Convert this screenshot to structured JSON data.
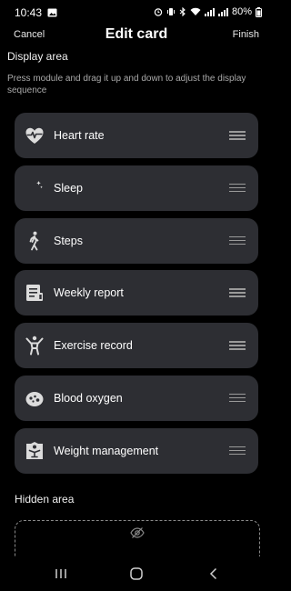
{
  "status_bar": {
    "time": "10:43",
    "battery": "80%",
    "icons": [
      "image-icon",
      "alarm-icon",
      "vibrate-icon",
      "bluetooth-icon",
      "wifi-icon",
      "signal-icon",
      "signal-icon",
      "battery-icon"
    ]
  },
  "header": {
    "cancel_label": "Cancel",
    "title": "Edit card",
    "finish_label": "Finish"
  },
  "display_area": {
    "title": "Display area",
    "description": "Press module and drag it up and down to adjust the display sequence"
  },
  "modules": [
    {
      "label": "Heart rate",
      "icon": "heart-rate-icon"
    },
    {
      "label": "Sleep",
      "icon": "moon-icon"
    },
    {
      "label": "Steps",
      "icon": "walking-icon"
    },
    {
      "label": "Weekly report",
      "icon": "report-icon"
    },
    {
      "label": "Exercise record",
      "icon": "exercise-icon"
    },
    {
      "label": "Blood oxygen",
      "icon": "blood-oxygen-icon"
    },
    {
      "label": "Weight management",
      "icon": "weight-icon"
    }
  ],
  "hidden_area": {
    "title": "Hidden area",
    "icon": "eye-off-icon"
  },
  "nav_bar": {
    "icons": [
      "recent-apps-icon",
      "home-icon",
      "back-icon"
    ]
  },
  "colors": {
    "background": "#000000",
    "module_background": "#2d2e33",
    "text_secondary": "#a9a9a9"
  }
}
